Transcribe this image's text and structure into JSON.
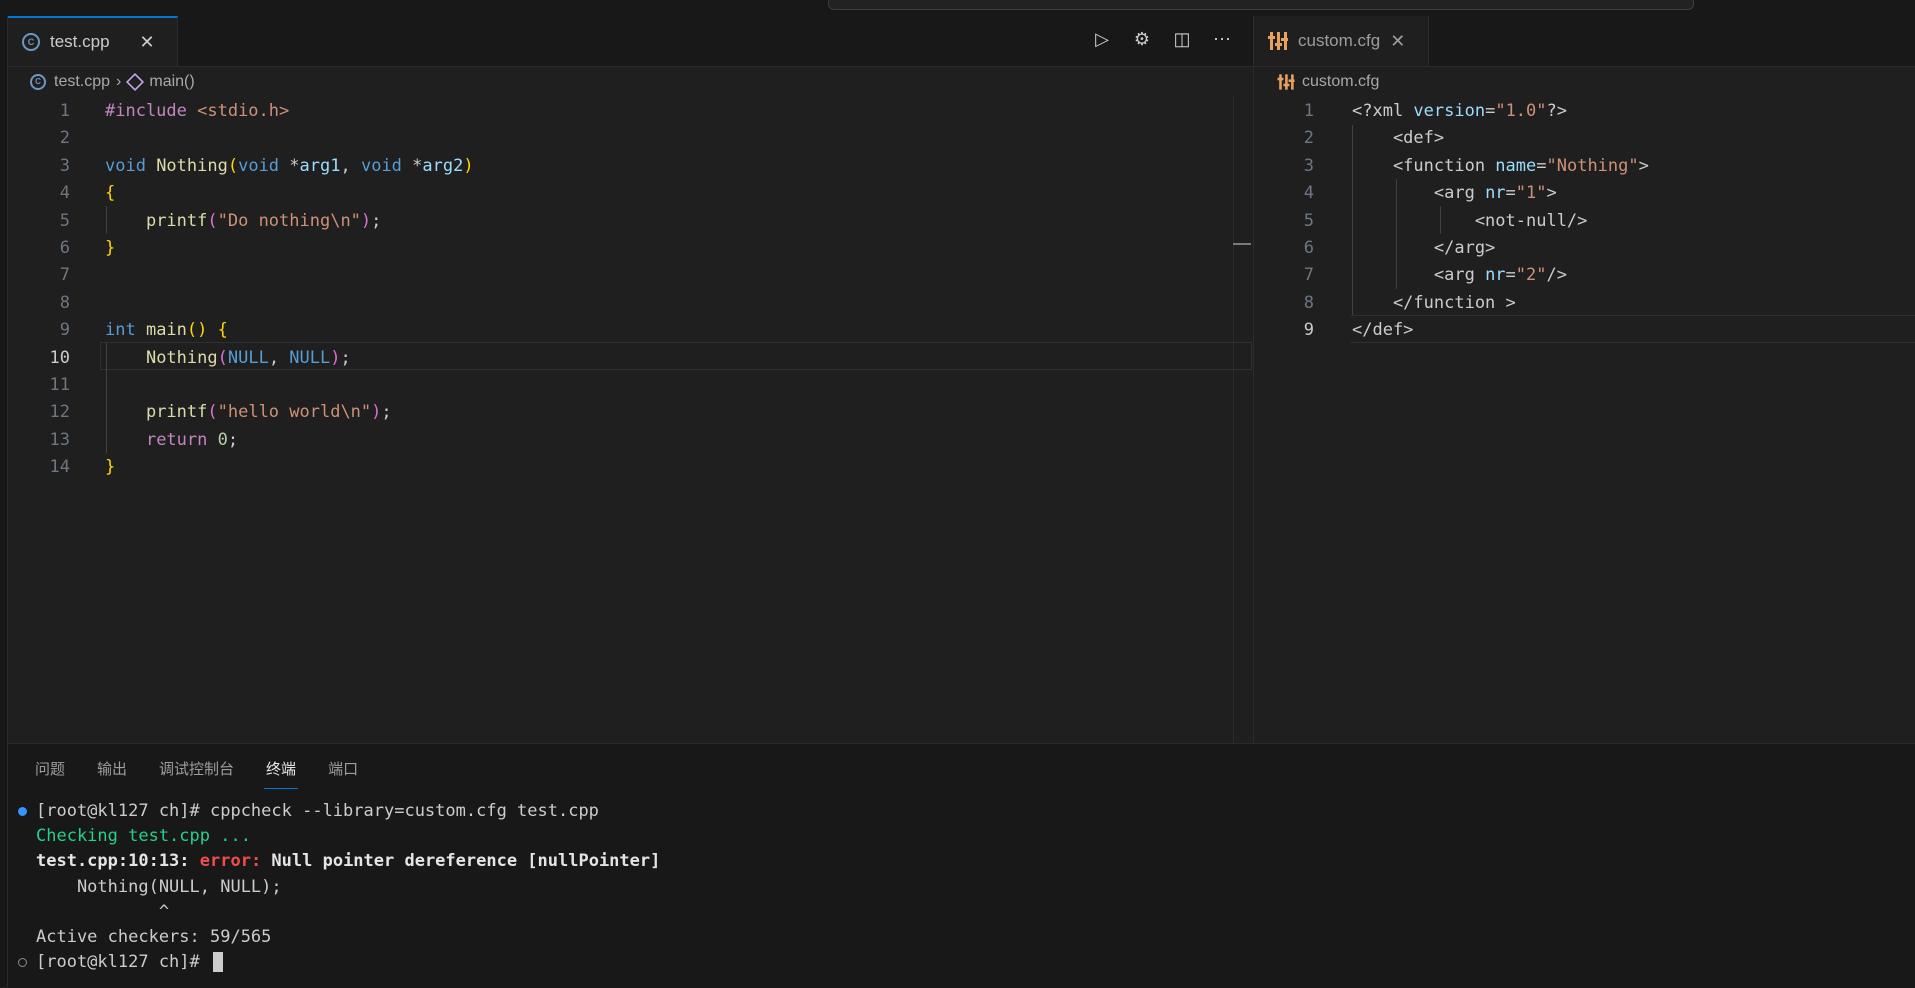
{
  "left_editor": {
    "tab": {
      "label": "test.cpp",
      "icon": "cpp-file-icon"
    },
    "breadcrumb": {
      "file": "test.cpp",
      "symbol": "main()"
    },
    "current_line": 10,
    "line_numbers": [
      "1",
      "2",
      "3",
      "4",
      "5",
      "6",
      "7",
      "8",
      "9",
      "10",
      "11",
      "12",
      "13",
      "14"
    ],
    "code": [
      [
        {
          "t": "#include ",
          "c": "ctl"
        },
        {
          "t": "<stdio.h>",
          "c": "str"
        }
      ],
      [],
      [
        {
          "t": "void ",
          "c": "kw"
        },
        {
          "t": "Nothing",
          "c": "fn"
        },
        {
          "t": "(",
          "c": "br1"
        },
        {
          "t": "void ",
          "c": "kw"
        },
        {
          "t": "*",
          "c": "pun"
        },
        {
          "t": "arg1",
          "c": "var"
        },
        {
          "t": ", ",
          "c": "pun"
        },
        {
          "t": "void ",
          "c": "kw"
        },
        {
          "t": "*",
          "c": "pun"
        },
        {
          "t": "arg2",
          "c": "var"
        },
        {
          "t": ")",
          "c": "br1"
        }
      ],
      [
        {
          "t": "{",
          "c": "br1"
        }
      ],
      [
        {
          "t": "    ",
          "c": "pun"
        },
        {
          "t": "printf",
          "c": "fn"
        },
        {
          "t": "(",
          "c": "br2"
        },
        {
          "t": "\"Do nothing\\n\"",
          "c": "str"
        },
        {
          "t": ")",
          "c": "br2"
        },
        {
          "t": ";",
          "c": "pun"
        }
      ],
      [
        {
          "t": "}",
          "c": "br1"
        }
      ],
      [],
      [],
      [
        {
          "t": "int ",
          "c": "kw"
        },
        {
          "t": "main",
          "c": "fn"
        },
        {
          "t": "() ",
          "c": "br1"
        },
        {
          "t": "{",
          "c": "br1"
        }
      ],
      [
        {
          "t": "    ",
          "c": "pun"
        },
        {
          "t": "Nothing",
          "c": "fn"
        },
        {
          "t": "(",
          "c": "br2"
        },
        {
          "t": "NULL",
          "c": "kw"
        },
        {
          "t": ", ",
          "c": "pun"
        },
        {
          "t": "NULL",
          "c": "kw"
        },
        {
          "t": ")",
          "c": "br2"
        },
        {
          "t": ";",
          "c": "pun"
        }
      ],
      [],
      [
        {
          "t": "    ",
          "c": "pun"
        },
        {
          "t": "printf",
          "c": "fn"
        },
        {
          "t": "(",
          "c": "br2"
        },
        {
          "t": "\"hello world\\n\"",
          "c": "str"
        },
        {
          "t": ")",
          "c": "br2"
        },
        {
          "t": ";",
          "c": "pun"
        }
      ],
      [
        {
          "t": "    ",
          "c": "pun"
        },
        {
          "t": "return ",
          "c": "ctl"
        },
        {
          "t": "0",
          "c": "num"
        },
        {
          "t": ";",
          "c": "pun"
        }
      ],
      [
        {
          "t": "}",
          "c": "br1"
        }
      ]
    ]
  },
  "right_editor": {
    "tab": {
      "label": "custom.cfg",
      "icon": "settings-file-icon"
    },
    "breadcrumb": {
      "file": "custom.cfg"
    },
    "current_line": 9,
    "line_numbers": [
      "1",
      "2",
      "3",
      "4",
      "5",
      "6",
      "7",
      "8",
      "9"
    ],
    "code": [
      [
        {
          "t": "<?xml ",
          "c": "tag"
        },
        {
          "t": "version",
          "c": "attr"
        },
        {
          "t": "=",
          "c": "pun"
        },
        {
          "t": "\"1.0\"",
          "c": "aval"
        },
        {
          "t": "?>",
          "c": "tag"
        }
      ],
      [
        {
          "t": "    <def>",
          "c": "tag"
        }
      ],
      [
        {
          "t": "    <function ",
          "c": "tag"
        },
        {
          "t": "name",
          "c": "attr"
        },
        {
          "t": "=",
          "c": "pun"
        },
        {
          "t": "\"Nothing\"",
          "c": "aval"
        },
        {
          "t": ">",
          "c": "tag"
        }
      ],
      [
        {
          "t": "        <arg ",
          "c": "tag"
        },
        {
          "t": "nr",
          "c": "attr"
        },
        {
          "t": "=",
          "c": "pun"
        },
        {
          "t": "\"1\"",
          "c": "aval"
        },
        {
          "t": ">",
          "c": "tag"
        }
      ],
      [
        {
          "t": "            <not-null/>",
          "c": "tag"
        }
      ],
      [
        {
          "t": "        </arg>",
          "c": "tag"
        }
      ],
      [
        {
          "t": "        <arg ",
          "c": "tag"
        },
        {
          "t": "nr",
          "c": "attr"
        },
        {
          "t": "=",
          "c": "pun"
        },
        {
          "t": "\"2\"",
          "c": "aval"
        },
        {
          "t": "/>",
          "c": "tag"
        }
      ],
      [
        {
          "t": "    </function >",
          "c": "tag"
        }
      ],
      [
        {
          "t": "</def>",
          "c": "tag"
        }
      ]
    ]
  },
  "editor_actions": [
    {
      "name": "run-debug-icon",
      "glyph": "▷"
    },
    {
      "name": "gear-icon",
      "glyph": "⚙"
    },
    {
      "name": "split-editor-icon",
      "glyph": "◫"
    },
    {
      "name": "more-actions-icon",
      "glyph": "⋯"
    }
  ],
  "panel": {
    "tabs": [
      "问题",
      "输出",
      "调试控制台",
      "终端",
      "端口"
    ],
    "active_tab": 3,
    "terminal": [
      {
        "dot": "filled",
        "parts": [
          {
            "t": "[root@kl127 ch]# cppcheck --library=custom.cfg test.cpp",
            "c": ""
          }
        ]
      },
      {
        "parts": [
          {
            "t": "Checking test.cpp ...",
            "c": "green"
          }
        ]
      },
      {
        "parts": [
          {
            "t": "test.cpp:10:13: ",
            "c": "bold"
          },
          {
            "t": "error: ",
            "c": "err"
          },
          {
            "t": "Null pointer dereference [nullPointer]",
            "c": "bold"
          }
        ]
      },
      {
        "parts": [
          {
            "t": "    Nothing(NULL, NULL);",
            "c": ""
          }
        ]
      },
      {
        "parts": [
          {
            "t": "            ^",
            "c": ""
          }
        ]
      },
      {
        "parts": [
          {
            "t": "Active checkers: 59/565",
            "c": ""
          }
        ]
      },
      {
        "dot": "empty",
        "cursor": true,
        "parts": [
          {
            "t": "[root@kl127 ch]# ",
            "c": ""
          }
        ]
      }
    ]
  }
}
